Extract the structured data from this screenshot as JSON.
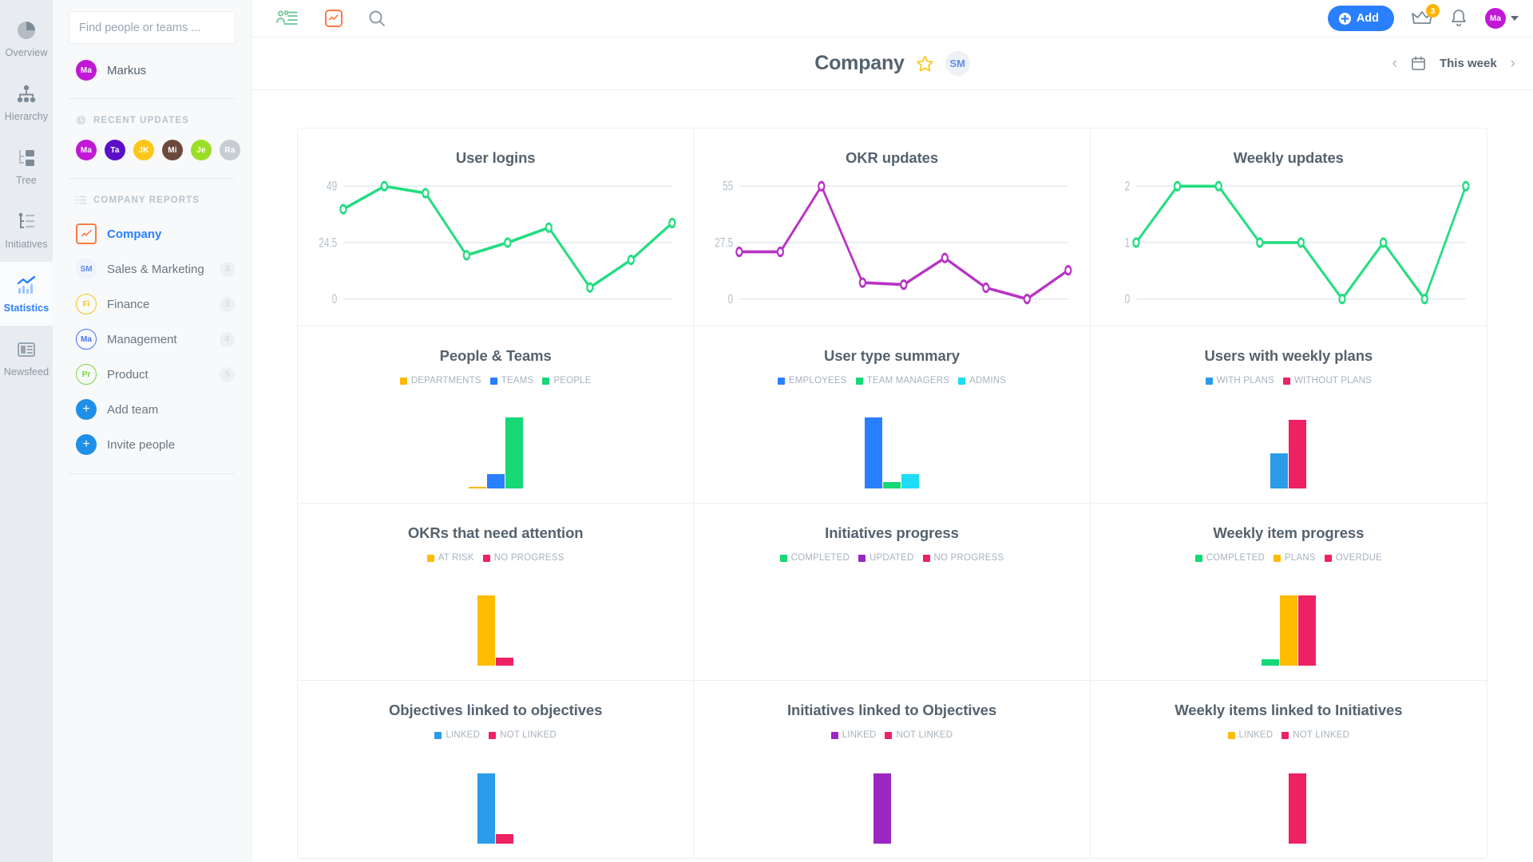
{
  "rail": {
    "items": [
      {
        "label": "Overview",
        "icon": "pie-chart-icon",
        "active": false
      },
      {
        "label": "Hierarchy",
        "icon": "hierarchy-icon",
        "active": false
      },
      {
        "label": "Tree",
        "icon": "tree-icon",
        "active": false
      },
      {
        "label": "Initiatives",
        "icon": "initiatives-icon",
        "active": false
      },
      {
        "label": "Statistics",
        "icon": "statistics-icon",
        "active": true
      },
      {
        "label": "Newsfeed",
        "icon": "newsfeed-icon",
        "active": false
      }
    ]
  },
  "sidebar": {
    "search_placeholder": "Find people or teams ...",
    "me": {
      "initials": "Ma",
      "name": "Markus",
      "color": "#c118d6"
    },
    "recent_updates_label": "RECENT UPDATES",
    "recent_avatars": [
      {
        "initials": "Ma",
        "color": "#c118d6"
      },
      {
        "initials": "Ta",
        "color": "#5b0fc7"
      },
      {
        "initials": "JK",
        "color": "#ffc61a"
      },
      {
        "initials": "Mi",
        "color": "#6b4a3d"
      },
      {
        "initials": "Je",
        "color": "#9ade28"
      },
      {
        "initials": "Ra",
        "color": "#c7cdd3"
      }
    ],
    "company_reports_label": "COMPANY REPORTS",
    "reports": [
      {
        "label": "Company",
        "initials": "",
        "active": true,
        "count": "",
        "style": "square",
        "color": "#ff7a45"
      },
      {
        "label": "Sales & Marketing",
        "initials": "SM",
        "active": false,
        "count": "3",
        "style": "plain",
        "color": "#5b8def"
      },
      {
        "label": "Finance",
        "initials": "Fi",
        "active": false,
        "count": "3",
        "style": "ring",
        "color": "#f5c518"
      },
      {
        "label": "Management",
        "initials": "Ma",
        "active": false,
        "count": "4",
        "style": "ring",
        "color": "#4a6ef5"
      },
      {
        "label": "Product",
        "initials": "Pr",
        "active": false,
        "count": "5",
        "style": "ring",
        "color": "#7dd63f"
      }
    ],
    "actions": [
      {
        "label": "Add team",
        "icon": "plus-icon"
      },
      {
        "label": "Invite people",
        "icon": "plus-icon"
      }
    ]
  },
  "topbar": {
    "icons": [
      {
        "name": "people-list-icon",
        "color": "#6fc497"
      },
      {
        "name": "report-square-icon",
        "color": "#ff7a45"
      },
      {
        "name": "search-icon",
        "color": "#8e99a4"
      }
    ],
    "add_label": "Add",
    "crown_badge": "3",
    "user_initials": "Ma",
    "user_color": "#c118d6"
  },
  "header": {
    "title": "Company",
    "star_icon": "star-icon",
    "avatar_initials": "SM",
    "date_label": "This week",
    "prev_icon": "chevron-left-icon",
    "next_icon": "chevron-right-icon",
    "calendar_icon": "calendar-icon"
  },
  "chart_data": [
    {
      "type": "line",
      "title": "User logins",
      "color": "#22dd80",
      "ylabel": "",
      "xlabel": "",
      "grid": true,
      "legend": [],
      "yticks": [
        "0",
        "24.5",
        "49"
      ],
      "ylim": [
        0,
        49
      ],
      "x": [
        1,
        2,
        3,
        4,
        5,
        6,
        7,
        8,
        9
      ],
      "values": [
        39,
        49,
        46,
        19,
        24.5,
        31,
        5,
        17,
        33
      ]
    },
    {
      "type": "line",
      "title": "OKR updates",
      "color": "#b734c4",
      "ylabel": "",
      "xlabel": "",
      "grid": true,
      "legend": [],
      "yticks": [
        "0",
        "27.5",
        "55"
      ],
      "ylim": [
        0,
        55
      ],
      "x": [
        1,
        2,
        3,
        4,
        5,
        6,
        7,
        8,
        9
      ],
      "values": [
        23,
        23,
        55,
        8,
        7,
        20,
        5.5,
        0,
        14
      ]
    },
    {
      "type": "line",
      "title": "Weekly updates",
      "color": "#22dd80",
      "ylabel": "",
      "xlabel": "",
      "grid": true,
      "legend": [],
      "yticks": [
        "0",
        "1",
        "2"
      ],
      "ylim": [
        0,
        2
      ],
      "x": [
        1,
        2,
        3,
        4,
        5,
        6,
        7,
        8,
        9
      ],
      "values": [
        1,
        2,
        2,
        1,
        1,
        0,
        1,
        0,
        2
      ]
    },
    {
      "type": "bar",
      "title": "People & Teams",
      "categories": [
        "DEPARTMENTS",
        "TEAMS",
        "PEOPLE"
      ],
      "colors": [
        "#ffb700",
        "#2a7fff",
        "#16d877"
      ],
      "values": [
        2,
        18,
        89
      ],
      "ylim": [
        0,
        92
      ]
    },
    {
      "type": "bar",
      "title": "User type summary",
      "categories": [
        "EMPLOYEES",
        "TEAM MANAGERS",
        "ADMINS"
      ],
      "colors": [
        "#2a7fff",
        "#16d877",
        "#1edcf5"
      ],
      "values": [
        89,
        8,
        18
      ],
      "ylim": [
        0,
        92
      ]
    },
    {
      "type": "bar",
      "title": "Users with weekly plans",
      "categories": [
        "WITH PLANS",
        "WITHOUT PLANS"
      ],
      "colors": [
        "#2a9ce8",
        "#ee2262"
      ],
      "values": [
        44,
        86
      ],
      "ylim": [
        0,
        92
      ]
    },
    {
      "type": "bar",
      "title": "OKRs that need attention",
      "categories": [
        "AT RISK",
        "NO PROGRESS"
      ],
      "colors": [
        "#ffbb00",
        "#ee2262"
      ],
      "values": [
        88,
        10
      ],
      "ylim": [
        0,
        92
      ]
    },
    {
      "type": "bar",
      "title": "Initiatives progress",
      "categories": [
        "COMPLETED",
        "UPDATED",
        "NO PROGRESS"
      ],
      "colors": [
        "#16d877",
        "#9b26c4",
        "#ee2262"
      ],
      "values": [
        0,
        0,
        0
      ],
      "ylim": [
        0,
        92
      ]
    },
    {
      "type": "bar",
      "title": "Weekly item progress",
      "categories": [
        "COMPLETED",
        "PLANS",
        "OVERDUE"
      ],
      "colors": [
        "#16d877",
        "#ffbb00",
        "#ee2262"
      ],
      "values": [
        8,
        88,
        88
      ],
      "ylim": [
        0,
        92
      ]
    },
    {
      "type": "bar",
      "title": "Objectives linked to objectives",
      "categories": [
        "LINKED",
        "NOT LINKED"
      ],
      "colors": [
        "#2a9ce8",
        "#ee2262"
      ],
      "values": [
        88,
        12
      ],
      "ylim": [
        0,
        92
      ]
    },
    {
      "type": "bar",
      "title": "Initiatives linked to Objectives",
      "categories": [
        "LINKED",
        "NOT LINKED"
      ],
      "colors": [
        "#9b26c4",
        "#ee2262"
      ],
      "values": [
        88,
        0
      ],
      "ylim": [
        0,
        92
      ]
    },
    {
      "type": "bar",
      "title": "Weekly items linked to Initiatives",
      "categories": [
        "LINKED",
        "NOT LINKED"
      ],
      "colors": [
        "#ffbb00",
        "#ee2262"
      ],
      "values": [
        0,
        88
      ],
      "ylim": [
        0,
        92
      ]
    }
  ]
}
